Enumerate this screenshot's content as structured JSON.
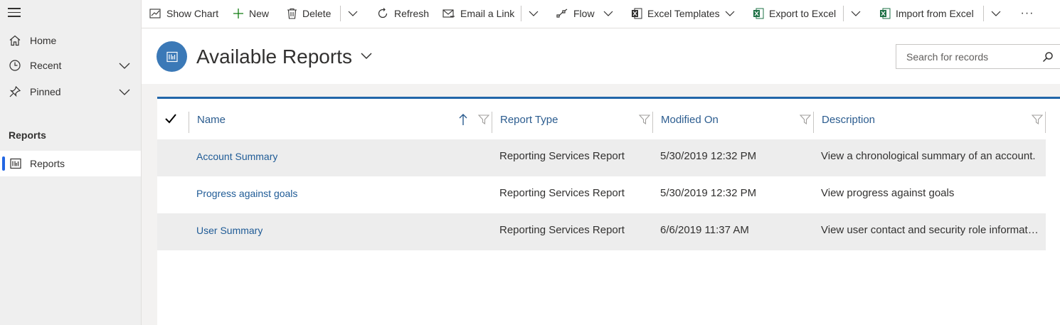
{
  "sidebar": {
    "items": [
      {
        "label": "Home",
        "icon": "home-icon"
      },
      {
        "label": "Recent",
        "icon": "clock-icon"
      },
      {
        "label": "Pinned",
        "icon": "pin-icon"
      }
    ],
    "section_title": "Reports",
    "section_items": [
      {
        "label": "Reports",
        "icon": "report-icon",
        "active": true
      }
    ]
  },
  "commands": {
    "show_chart": "Show Chart",
    "new": "New",
    "delete": "Delete",
    "refresh": "Refresh",
    "email_link": "Email a Link",
    "flow": "Flow",
    "excel_templates": "Excel Templates",
    "export_excel": "Export to Excel",
    "import_excel": "Import from Excel",
    "more": "···"
  },
  "header": {
    "title": "Available Reports",
    "search_placeholder": "Search for records"
  },
  "grid": {
    "columns": [
      "Name",
      "Report Type",
      "Modified On",
      "Description"
    ],
    "rows": [
      {
        "name": "Account Summary",
        "type": "Reporting Services Report",
        "modified": "5/30/2019 12:32 PM",
        "description": "View a chronological summary of an account."
      },
      {
        "name": "Progress against goals",
        "type": "Reporting Services Report",
        "modified": "5/30/2019 12:32 PM",
        "description": "View progress against goals"
      },
      {
        "name": "User Summary",
        "type": "Reporting Services Report",
        "modified": "6/6/2019 11:37 AM",
        "description": "View user contact and security role information for all users."
      }
    ]
  },
  "colors": {
    "accent": "#2266a9",
    "link": "#1f5b96",
    "page_icon_bg": "#3b79b7",
    "excel_green": "#1e7145",
    "active_bar": "#2266e3"
  }
}
